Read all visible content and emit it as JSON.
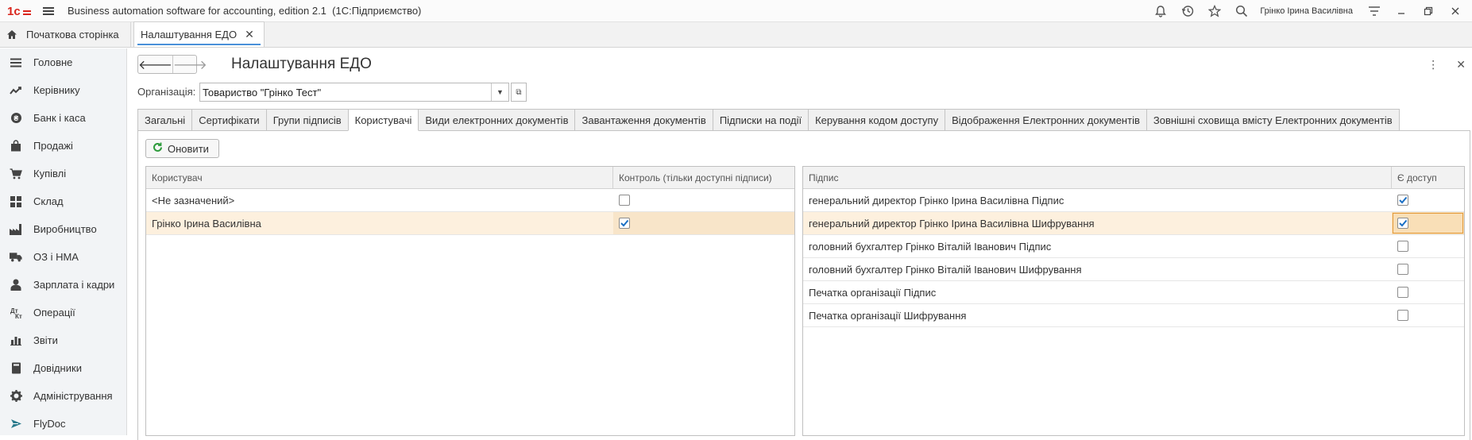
{
  "titlebar": {
    "app_title": "Business automation software for accounting, edition 2.1  (1С:Підприємство)",
    "user": "Грінко Ірина Василівна"
  },
  "window_tabs": {
    "home": "Початкова сторінка",
    "active": "Налаштування ЕДО"
  },
  "sidebar": {
    "items": [
      {
        "label": "Головне",
        "icon": "menu-lines-icon"
      },
      {
        "label": "Керівнику",
        "icon": "trend-icon"
      },
      {
        "label": "Банк і каса",
        "icon": "coin-icon"
      },
      {
        "label": "Продажі",
        "icon": "bag-icon"
      },
      {
        "label": "Купівлі",
        "icon": "cart-icon"
      },
      {
        "label": "Склад",
        "icon": "grid-icon"
      },
      {
        "label": "Виробництво",
        "icon": "factory-icon"
      },
      {
        "label": "ОЗ і НМА",
        "icon": "truck-icon"
      },
      {
        "label": "Зарплата і кадри",
        "icon": "person-icon"
      },
      {
        "label": "Операції",
        "icon": "operations-icon"
      },
      {
        "label": "Звіти",
        "icon": "bar-chart-icon"
      },
      {
        "label": "Довідники",
        "icon": "book-icon"
      },
      {
        "label": "Адміністрування",
        "icon": "gear-icon"
      },
      {
        "label": "FlyDoc",
        "icon": "flydoc-icon"
      }
    ]
  },
  "form": {
    "title": "Налаштування ЕДО",
    "org_label": "Організація:",
    "org_value": "Товариство \"Грінко Тест\"",
    "tabs": [
      "Загальні",
      "Сертифікати",
      "Групи підписів",
      "Користувачі",
      "Види електронних документів",
      "Завантаження документів",
      "Підписки на події",
      "Керування кодом доступу",
      "Відображення Електронних документів",
      "Зовнішні сховища вмісту Електронних документів"
    ],
    "active_tab": "Користувачі",
    "refresh_label": "Оновити"
  },
  "users_table": {
    "columns": [
      "Користувач",
      "Контроль (тільки доступні підписи)"
    ],
    "rows": [
      {
        "user": "<Не зазначений>",
        "control": false
      },
      {
        "user": "Грінко Ірина Василівна",
        "control": true
      }
    ]
  },
  "signatures_table": {
    "columns": [
      "Підпис",
      "Є доступ"
    ],
    "rows": [
      {
        "signature": "генеральний директор Грінко Ірина Василівна Підпис",
        "access": true
      },
      {
        "signature": "генеральний директор Грінко Ірина Василівна Шифрування",
        "access": true
      },
      {
        "signature": "головний бухгалтер Грінко Віталій Іванович Підпис",
        "access": false
      },
      {
        "signature": "головний бухгалтер Грінко Віталій Іванович Шифрування",
        "access": false
      },
      {
        "signature": "Печатка організації Підпис",
        "access": false
      },
      {
        "signature": "Печатка організації Шифрування",
        "access": false
      }
    ]
  },
  "colors": {
    "selected_row": "#fdf0de",
    "focus_cell": "#f9dfb7",
    "checkmark": "#1a6fc4",
    "logo": "#d9251d"
  }
}
